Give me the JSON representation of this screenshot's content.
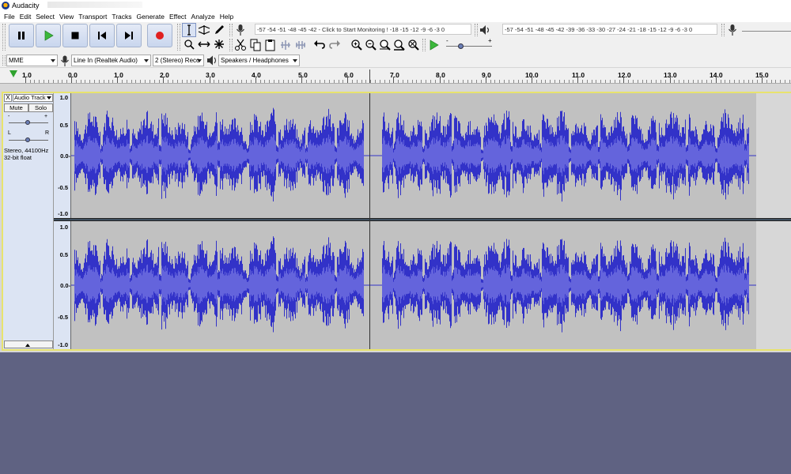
{
  "window": {
    "title": "Audacity"
  },
  "menu": [
    "File",
    "Edit",
    "Select",
    "View",
    "Transport",
    "Tracks",
    "Generate",
    "Effect",
    "Analyze",
    "Help"
  ],
  "transport": {
    "buttons": [
      "pause-icon",
      "play-icon",
      "stop-icon",
      "skip-start-icon",
      "skip-end-icon",
      "record-icon"
    ]
  },
  "tools": [
    "selection-tool-icon",
    "envelope-tool-icon",
    "draw-tool-icon",
    "zoom-tool-icon",
    "timeshift-tool-icon",
    "multi-tool-icon"
  ],
  "recording_meter": {
    "scale_left": "-57 -54 -51 -48 -45 -42 -",
    "prompt": "Click to Start Monitoring",
    "scale_right": "! -18 -15 -12  -9  -6  -3  0",
    "channels": "L\nR"
  },
  "playback_meter": {
    "scale": "-57 -54 -51 -48 -45 -42 -39 -36 -33 -30 -27 -24 -21 -18 -15 -12  -9  -6  -3  0",
    "channels": "L\nR"
  },
  "edit_toolbar": [
    "cut-icon",
    "copy-icon",
    "paste-icon",
    "trim-icon",
    "silence-icon",
    "undo-icon",
    "redo-icon",
    "zoom-in-icon",
    "zoom-out-icon",
    "fit-selection-icon",
    "fit-project-icon",
    "zoom-toggle-icon"
  ],
  "play_at_speed": {
    "min": "-",
    "max": "+"
  },
  "devices": {
    "host": "MME",
    "input": "Line In (Realtek Audio)",
    "channels": "2 (Stereo) Reco",
    "output": "Speakers / Headphones"
  },
  "timeline": {
    "labels": [
      "1.0",
      "0.0",
      "1.0",
      "2.0",
      "3.0",
      "4.0",
      "5.0",
      "6.0",
      "7.0",
      "8.0",
      "9.0",
      "10.0",
      "11.0",
      "12.0",
      "13.0",
      "14.0",
      "15.0"
    ]
  },
  "track": {
    "name": "Audio Track",
    "close": "X",
    "mute": "Mute",
    "solo": "Solo",
    "gain_minus": "-",
    "gain_plus": "+",
    "pan_left": "L",
    "pan_right": "R",
    "format_line1": "Stereo, 44100Hz",
    "format_line2": "32-bit float",
    "vertical_scale": [
      "1.0",
      "0.5",
      "0.0-",
      "-0.5",
      "-1.0"
    ]
  },
  "colors": {
    "waveform": "#3232c8",
    "waveform_rms": "#6464dc",
    "wave_background": "#c1c1c1",
    "selected_border": "#e8e36d",
    "desktop": "#5f6282"
  }
}
